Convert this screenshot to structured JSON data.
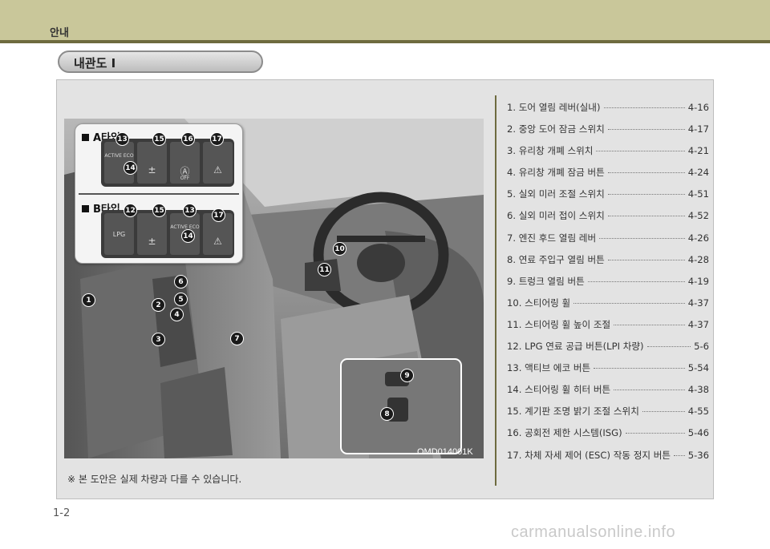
{
  "header": {
    "title": "안내"
  },
  "section": {
    "title": "내관도 I"
  },
  "figure": {
    "type_a_label": "A타입",
    "type_b_label": "B타입",
    "switch_active_eco": "ACTIVE ECO",
    "switch_lpg": "LPG",
    "switch_off": "OFF",
    "code": "OMD014001K",
    "badges": {
      "b1": "1",
      "b2": "2",
      "b3": "3",
      "b4": "4",
      "b5": "5",
      "b6": "6",
      "b7": "7",
      "b8": "8",
      "b9": "9",
      "b10": "10",
      "b11": "11",
      "b12": "12",
      "b13": "13",
      "b14": "14",
      "b15": "15",
      "b16": "16",
      "b17": "17"
    }
  },
  "note": "※ 본 도안은 실제 차량과 다를 수 있습니다.",
  "toc": [
    {
      "title": "1. 도어 열림 레버(실내)",
      "page": "4-16"
    },
    {
      "title": "2. 중앙 도어 잠금 스위치",
      "page": "4-17"
    },
    {
      "title": "3. 유리창 개폐 스위치",
      "page": "4-21"
    },
    {
      "title": "4. 유리창 개폐 잠금 버튼",
      "page": "4-24"
    },
    {
      "title": "5. 실외 미러 조절 스위치",
      "page": "4-51"
    },
    {
      "title": "6. 실외 미러 접이 스위치",
      "page": "4-52"
    },
    {
      "title": "7. 엔진 후드 열림 레버",
      "page": "4-26"
    },
    {
      "title": "8. 연료 주입구 열림 버튼",
      "page": "4-28"
    },
    {
      "title": "9. 트렁크 열림 버튼",
      "page": "4-19"
    },
    {
      "title": "10. 스티어링 휠",
      "page": "4-37"
    },
    {
      "title": "11. 스티어링 휠 높이 조절",
      "page": "4-37"
    },
    {
      "title": "12. LPG 연료 공급 버튼(LPI 차량)",
      "page": "5-6"
    },
    {
      "title": "13. 액티브 에코 버튼",
      "page": "5-54"
    },
    {
      "title": "14.  스티어링 휠 히터 버튼",
      "page": "4-38"
    },
    {
      "title": "15. 계기판 조명 밝기 조절 스위치",
      "page": "4-55"
    },
    {
      "title": "16. 공회전 제한 시스템(ISG)",
      "page": "5-46"
    },
    {
      "title": "17. 차체 자세 제어 (ESC) 작동 정지 버튼",
      "page": "5-36"
    }
  ],
  "page_number": "1-2",
  "watermark": "carmanualsonline.info"
}
